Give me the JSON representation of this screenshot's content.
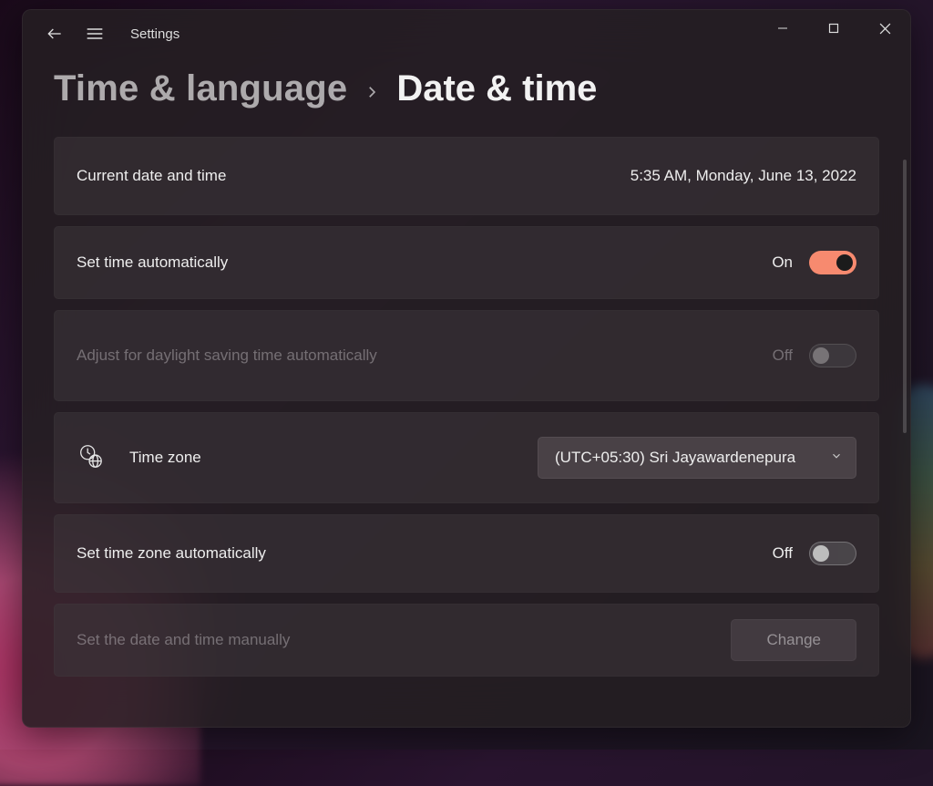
{
  "titlebar": {
    "title": "Settings"
  },
  "breadcrumb": {
    "parent": "Time & language",
    "current": "Date & time"
  },
  "rows": {
    "current": {
      "label": "Current date and time",
      "value": "5:35 AM, Monday, June 13, 2022"
    },
    "setTimeAuto": {
      "label": "Set time automatically",
      "state": "On"
    },
    "dstAuto": {
      "label": "Adjust for daylight saving time automatically",
      "state": "Off"
    },
    "timezone": {
      "label": "Time zone",
      "selected": "(UTC+05:30) Sri Jayawardenepura"
    },
    "setTzAuto": {
      "label": "Set time zone automatically",
      "state": "Off"
    },
    "setManual": {
      "label": "Set the date and time manually",
      "button": "Change"
    }
  }
}
